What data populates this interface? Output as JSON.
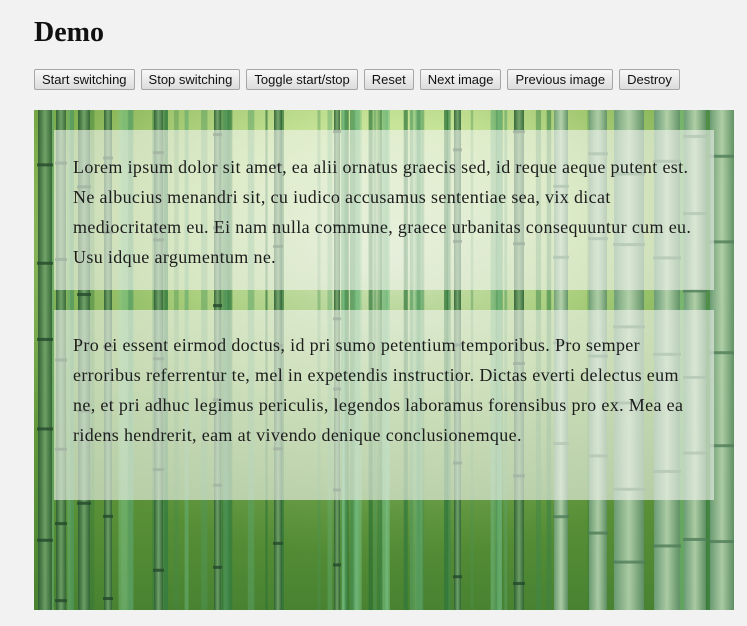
{
  "page": {
    "title": "Demo"
  },
  "toolbar": {
    "buttons": [
      {
        "label": "Start switching"
      },
      {
        "label": "Stop switching"
      },
      {
        "label": "Toggle start/stop"
      },
      {
        "label": "Reset"
      },
      {
        "label": "Next image"
      },
      {
        "label": "Previous image"
      },
      {
        "label": "Destroy"
      }
    ]
  },
  "slideshow": {
    "background": "bamboo-forest-image",
    "colors": {
      "sky": "#e4f3c8",
      "foliage": "#8cc447",
      "stalk_dark": "#2f6b3a",
      "stalk_light": "#8fbf8a",
      "panel_overlay": "#f0f4ee"
    },
    "paragraphs": [
      {
        "text": "Lorem ipsum dolor sit amet, ea alii ornatus graecis sed, id reque aeque putent est. Ne albucius menandri sit, cu iudico accusamus sententiae sea, vix dicat mediocritatem eu. Ei nam nulla commune, graece urbanitas consequuntur cum eu. Usu idque argumentum ne."
      },
      {
        "text": "Pro ei essent eirmod doctus, id pri sumo petentium temporibus. Pro semper erroribus referrentur te, mel in expetendis instructior. Dictas everti delectus eum ne, et pri adhuc legimus periculis, legendos laboramus forensibus pro ex. Mea ea ridens hendrerit, eam at vivendo denique conclusionemque."
      }
    ]
  }
}
